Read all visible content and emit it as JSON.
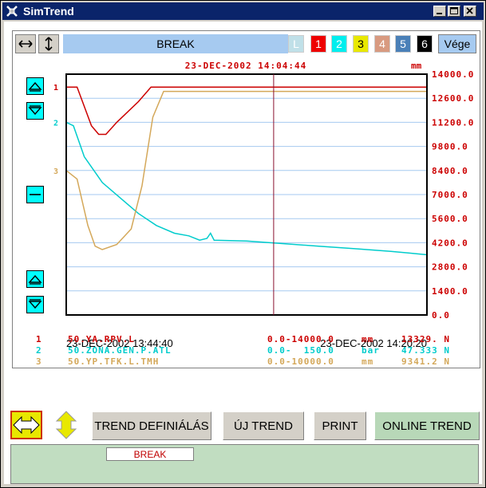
{
  "window": {
    "title": "SimTrend"
  },
  "toolbar": {
    "break_label": "BREAK",
    "l_label": "L",
    "chip1": "1",
    "chip2": "2",
    "chip3": "3",
    "chip4": "4",
    "chip5": "5",
    "chip6": "6",
    "exit_label": "Vége"
  },
  "chart": {
    "timestamp": "23-DEC-2002 14:04:44",
    "unit": "mm",
    "start_time": "23-DEC-2002 13:44:40",
    "end_time": "23-DEC-2002 14:20:20",
    "y_ticks": [
      "14000.0",
      "12600.0",
      "11200.0",
      "9800.0",
      "8400.0",
      "7000.0",
      "5600.0",
      "4200.0",
      "2800.0",
      "1400.0",
      "0.0"
    ],
    "series_markers": [
      "1",
      "2",
      "3"
    ]
  },
  "chart_data": {
    "type": "line",
    "x": [
      "13:44:40",
      "14:20:20"
    ],
    "ylim": [
      0,
      14000
    ],
    "ylabel": "mm",
    "series": [
      {
        "name": "50.YA.RPV.L",
        "color": "#cc0000",
        "points": [
          [
            0,
            13250
          ],
          [
            0.03,
            13250
          ],
          [
            0.07,
            11000
          ],
          [
            0.09,
            10500
          ],
          [
            0.11,
            10500
          ],
          [
            0.14,
            11200
          ],
          [
            0.2,
            12400
          ],
          [
            0.235,
            13250
          ],
          [
            1,
            13250
          ]
        ]
      },
      {
        "name": "50.ZONA.GEN.P.ATL",
        "color": "#00cccc",
        "points": [
          [
            0,
            11200
          ],
          [
            0.02,
            11000
          ],
          [
            0.05,
            9200
          ],
          [
            0.1,
            7700
          ],
          [
            0.15,
            6800
          ],
          [
            0.2,
            5900
          ],
          [
            0.25,
            5200
          ],
          [
            0.3,
            4750
          ],
          [
            0.34,
            4600
          ],
          [
            0.37,
            4350
          ],
          [
            0.39,
            4450
          ],
          [
            0.4,
            4750
          ],
          [
            0.41,
            4350
          ],
          [
            0.5,
            4300
          ],
          [
            0.6,
            4150
          ],
          [
            0.7,
            4000
          ],
          [
            0.8,
            3850
          ],
          [
            0.9,
            3700
          ],
          [
            1,
            3500
          ]
        ]
      },
      {
        "name": "50.YP.TFK.L.TMH",
        "color": "#d4a85a",
        "points": [
          [
            0,
            8400
          ],
          [
            0.03,
            7900
          ],
          [
            0.06,
            5200
          ],
          [
            0.08,
            4000
          ],
          [
            0.1,
            3800
          ],
          [
            0.14,
            4100
          ],
          [
            0.18,
            5000
          ],
          [
            0.21,
            7500
          ],
          [
            0.24,
            11500
          ],
          [
            0.27,
            13000
          ],
          [
            1,
            13000
          ]
        ]
      }
    ],
    "cursor_x": 0.575,
    "grid": true
  },
  "legend": [
    {
      "no": "1",
      "name": "50.YA.RPV.L",
      "range": "0.0-14000.0",
      "unit": "mm",
      "value": "13329. N",
      "color": "#cc0000"
    },
    {
      "no": "2",
      "name": "50.ZONA.GEN.P.ATL",
      "range": "0.0-  150.0",
      "unit": "bar",
      "value": "47.333 N",
      "color": "#00cccc"
    },
    {
      "no": "3",
      "name": "50.YP.TFK.L.TMH",
      "range": "0.0-10000.0",
      "unit": "mm",
      "value": "9341.2 N",
      "color": "#d4a85a"
    }
  ],
  "bottom": {
    "trend_def": "TREND DEFINIÁLÁS",
    "new_trend": "ÚJ TREND",
    "print": "PRINT",
    "online_trend": "ONLINE TREND",
    "status": "BREAK"
  }
}
